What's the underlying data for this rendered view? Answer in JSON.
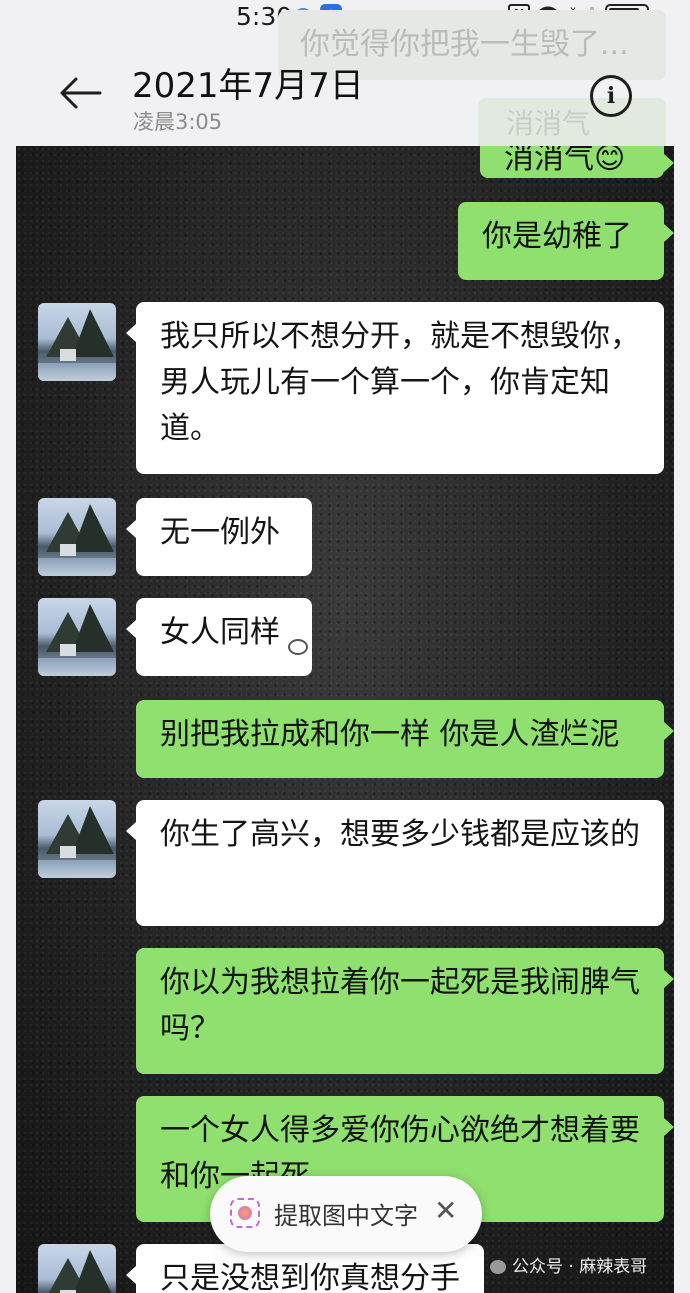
{
  "status_bar": {
    "time": "5:30"
  },
  "ghost_bubbles": {
    "top": "你觉得你把我一生毁了...",
    "second": "消消气"
  },
  "header": {
    "title": "2021年7月7日",
    "subtitle": "凌晨3:05"
  },
  "messages": [
    {
      "side": "out",
      "text": "消消气😊"
    },
    {
      "side": "out",
      "text": "你是幼稚了"
    },
    {
      "side": "in",
      "text": "我只所以不想分开，就是不想毁你，男人玩儿有一个算一个，你肯定知道。"
    },
    {
      "side": "in",
      "text": "无一例外"
    },
    {
      "side": "in",
      "text": "女人同样"
    },
    {
      "side": "out",
      "text": "别把我拉成和你一样 你是人渣烂泥"
    },
    {
      "side": "in",
      "text": "你生了高兴，想要多少钱都是应该的"
    },
    {
      "side": "out",
      "text": "你以为我想拉着你一起死是我闹脾气吗？"
    },
    {
      "side": "out",
      "text": "一个女人得多爱你伤心欲绝才想着要和你一起死"
    },
    {
      "side": "in",
      "text": "只是没想到你真想分手"
    }
  ],
  "watermark": {
    "weibo": "@麻辣表哥",
    "footer": "公众号 · 麻辣表哥"
  },
  "extract_pill": {
    "label": "提取图中文字",
    "close": "✕"
  },
  "colors": {
    "outgoing_bubble": "#8fe06e",
    "incoming_bubble": "#fefefe"
  }
}
